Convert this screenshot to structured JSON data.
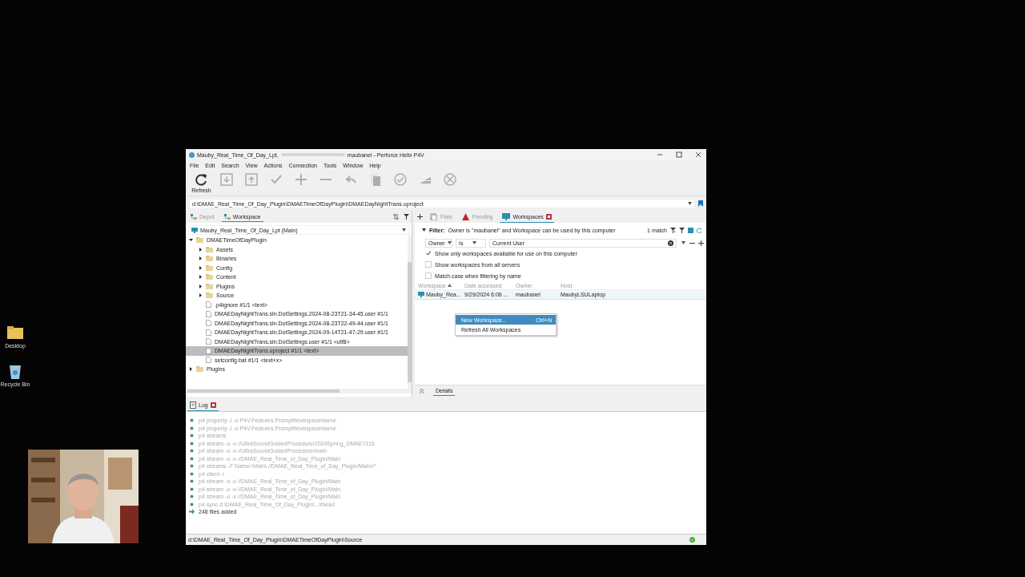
{
  "desktop": {
    "icons": [
      {
        "label": "Desktop",
        "kind": "folder"
      },
      {
        "label": "Recycle Bin",
        "kind": "bin"
      }
    ]
  },
  "window": {
    "title_parts": [
      "Mauby_Real_Time_Of_Day_Lpt,",
      "maubanel - Perforce Helix P4V"
    ],
    "menu": [
      "File",
      "Edit",
      "Search",
      "View",
      "Actions",
      "Connection",
      "Tools",
      "Window",
      "Help"
    ],
    "toolbar": [
      {
        "kind": "refresh",
        "label": "Refresh",
        "disabled": false
      },
      {
        "kind": "get",
        "disabled": true
      },
      {
        "kind": "checkout",
        "disabled": true
      },
      {
        "kind": "submit",
        "disabled": true
      },
      {
        "kind": "add",
        "disabled": true
      },
      {
        "kind": "delete",
        "disabled": true
      },
      {
        "kind": "revert",
        "disabled": true
      },
      {
        "kind": "diff",
        "disabled": true
      },
      {
        "kind": "resolve",
        "disabled": true
      },
      {
        "kind": "timelapse",
        "disabled": true
      },
      {
        "kind": "stop",
        "disabled": true
      }
    ],
    "path": "d:\\DMAE_Real_Time_Of_Day_Plugin\\DMAETimeOfDayPlugin\\DMAEDayNightTrans.uproject",
    "left_tabs": [
      {
        "label": "Depot",
        "selected": false
      },
      {
        "label": "Workspace",
        "selected": true
      }
    ],
    "workspace_combo": "Mauby_Real_Time_Of_Day_Lpt (Main)",
    "tree": [
      {
        "label": "DMAETimeOfDayPlugin",
        "kind": "folder",
        "expanded": true,
        "selected": false,
        "children": [
          {
            "label": "Assets",
            "kind": "folder",
            "expanded": false,
            "selected": false
          },
          {
            "label": "Binaries",
            "kind": "folder",
            "expanded": false,
            "selected": false
          },
          {
            "label": "Config",
            "kind": "folder",
            "expanded": false,
            "selected": false
          },
          {
            "label": "Content",
            "kind": "folder",
            "expanded": false,
            "selected": false
          },
          {
            "label": "Plugins",
            "kind": "folder",
            "expanded": false,
            "selected": false
          },
          {
            "label": "Source",
            "kind": "folder",
            "expanded": false,
            "selected": false
          },
          {
            "label": ".p4ignore #1/1 <text>",
            "kind": "file",
            "selected": false
          },
          {
            "label": "DMAEDayNightTrans.sln.DotSettings.2024-08-23T21-34-45.user #1/1",
            "kind": "file",
            "selected": false
          },
          {
            "label": "DMAEDayNightTrans.sln.DotSettings.2024-08-23T22-49-44.user #1/1",
            "kind": "file",
            "selected": false
          },
          {
            "label": "DMAEDayNightTrans.sln.DotSettings.2024-09-14T21-47-29.user #1/1",
            "kind": "file",
            "selected": false
          },
          {
            "label": "DMAEDayNightTrans.sln.DotSettings.user #1/1 <utf8>",
            "kind": "file",
            "selected": false
          },
          {
            "label": "DMAEDayNightTrans.uproject #1/1 <text>",
            "kind": "file",
            "selected": true
          },
          {
            "label": "setconfig.bat #1/1 <text+x>",
            "kind": "file",
            "selected": false
          }
        ]
      },
      {
        "label": "Plugins",
        "kind": "folder",
        "expanded": false,
        "selected": false
      }
    ],
    "right_tabs": [
      {
        "label": "Files",
        "kind": "files",
        "selected": false
      },
      {
        "label": "Pending",
        "kind": "pending",
        "selected": false
      },
      {
        "label": "Workspaces",
        "kind": "workspaces",
        "selected": true
      }
    ],
    "filter": {
      "label": "Filter:",
      "summary": "Owner is \"maubanel\" and Workspace can be used by this computer",
      "matches": "1 match",
      "field": "Owner",
      "operator": "Is",
      "value": "Current User"
    },
    "options": [
      {
        "label": "Show only workspaces available for use on this computer",
        "checked": true
      },
      {
        "label": "Show workspaces from all servers",
        "checked": false
      },
      {
        "label": "Match case when filtering by name",
        "checked": false
      }
    ],
    "table": {
      "columns": [
        "Workspace",
        "Date accessed",
        "Owner",
        "Host"
      ],
      "rows": [
        [
          "Mauby_Rea...",
          "9/29/2024 6:06 ...",
          "maubanel",
          "MaubyLSULaptop"
        ]
      ]
    },
    "context_menu": [
      {
        "label": "New Workspace...",
        "shortcut": "Ctrl+N",
        "selected": true
      },
      {
        "label": "Refresh All Workspaces",
        "selected": false
      }
    ],
    "details_tab": "Details",
    "log_tab": "Log",
    "log": [
      {
        "kind": "info",
        "text": "p4 property -l -n P4V.Features.PromptWorkspaceName"
      },
      {
        "kind": "info",
        "text": "p4 property -l -n P4V.Features.PromptWorkspaceName"
      },
      {
        "kind": "info",
        "text": "p4 streams"
      },
      {
        "kind": "info",
        "text": "p4 stream -o -v //UltraSoundGuidedProcedure/2024Spring_DMAE7115"
      },
      {
        "kind": "info",
        "text": "p4 stream -o -v //UltraSoundGuidedProcedure/main"
      },
      {
        "kind": "info",
        "text": "p4 stream -o -v //DMAE_Real_Time_of_Day_Plugin/Main"
      },
      {
        "kind": "info",
        "text": "p4 streams -F Name=Main\\ //DMAE_Real_Time_of_Day_Plugin/Main//*"
      },
      {
        "kind": "info",
        "text": "p4 client -i"
      },
      {
        "kind": "info",
        "text": "p4 stream -o -v //DMAE_Real_Time_of_Day_Plugin/Main"
      },
      {
        "kind": "info",
        "text": "p4 stream -o -v //DMAE_Real_Time_of_Day_Plugin/Main"
      },
      {
        "kind": "info",
        "text": "p4 stream -o -v //DMAE_Real_Time_of_Day_Plugin/Main"
      },
      {
        "kind": "info",
        "text": "p4 sync d:\\DMAE_Real_Time_Of_Day_Plugin\\...#head"
      },
      {
        "kind": "result",
        "text": "248 files added"
      }
    ],
    "status_bar": "d:\\DMAE_Real_Time_Of_Day_Plugin\\DMAETimeOfDayPlugin\\Source"
  }
}
